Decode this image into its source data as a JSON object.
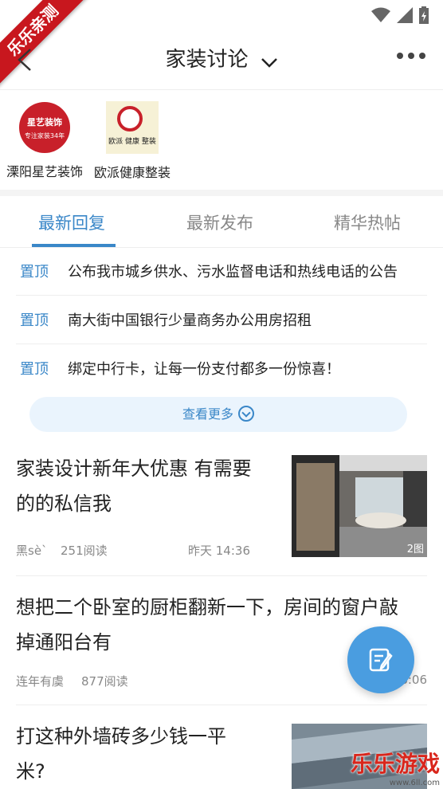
{
  "ribbon": "乐乐亲测",
  "header": {
    "title": "家装讨论"
  },
  "stores": [
    {
      "name": "溧阳星艺装饰",
      "logo_brand": "星艺装饰",
      "logo_sub": "专注家装34年"
    },
    {
      "name": "欧派健康整装",
      "logo_text": "欧派 健康 整装"
    }
  ],
  "tabs": [
    "最新回复",
    "最新发布",
    "精华热帖"
  ],
  "pinned": [
    {
      "tag": "置顶",
      "text": "公布我市城乡供水、污水监督电话和热线电话的公告"
    },
    {
      "tag": "置顶",
      "text": "南大街中国银行少量商务办公用房招租"
    },
    {
      "tag": "置顶",
      "text": "绑定中行卡，让每一份支付都多一份惊喜！"
    }
  ],
  "see_more": "查看更多",
  "posts": [
    {
      "title_line1": "家装设计新年大优惠   有需要",
      "title_line2": "的的私信我",
      "author": "黑sè`",
      "views": "251阅读",
      "time": "昨天 14:36",
      "img_count": "2图"
    },
    {
      "title_line1": "想把二个卧室的厨柜翻新一下，房间的窗户敲",
      "title_line2": "掉通阳台有",
      "author": "连年有虞",
      "views": "877阅读",
      "time": "6:06"
    },
    {
      "title_line1": "打这种外墙砖多少钱一平",
      "title_line2": "米?"
    }
  ],
  "watermark": {
    "big": "乐乐游戏",
    "small": "www.6ll.com"
  }
}
